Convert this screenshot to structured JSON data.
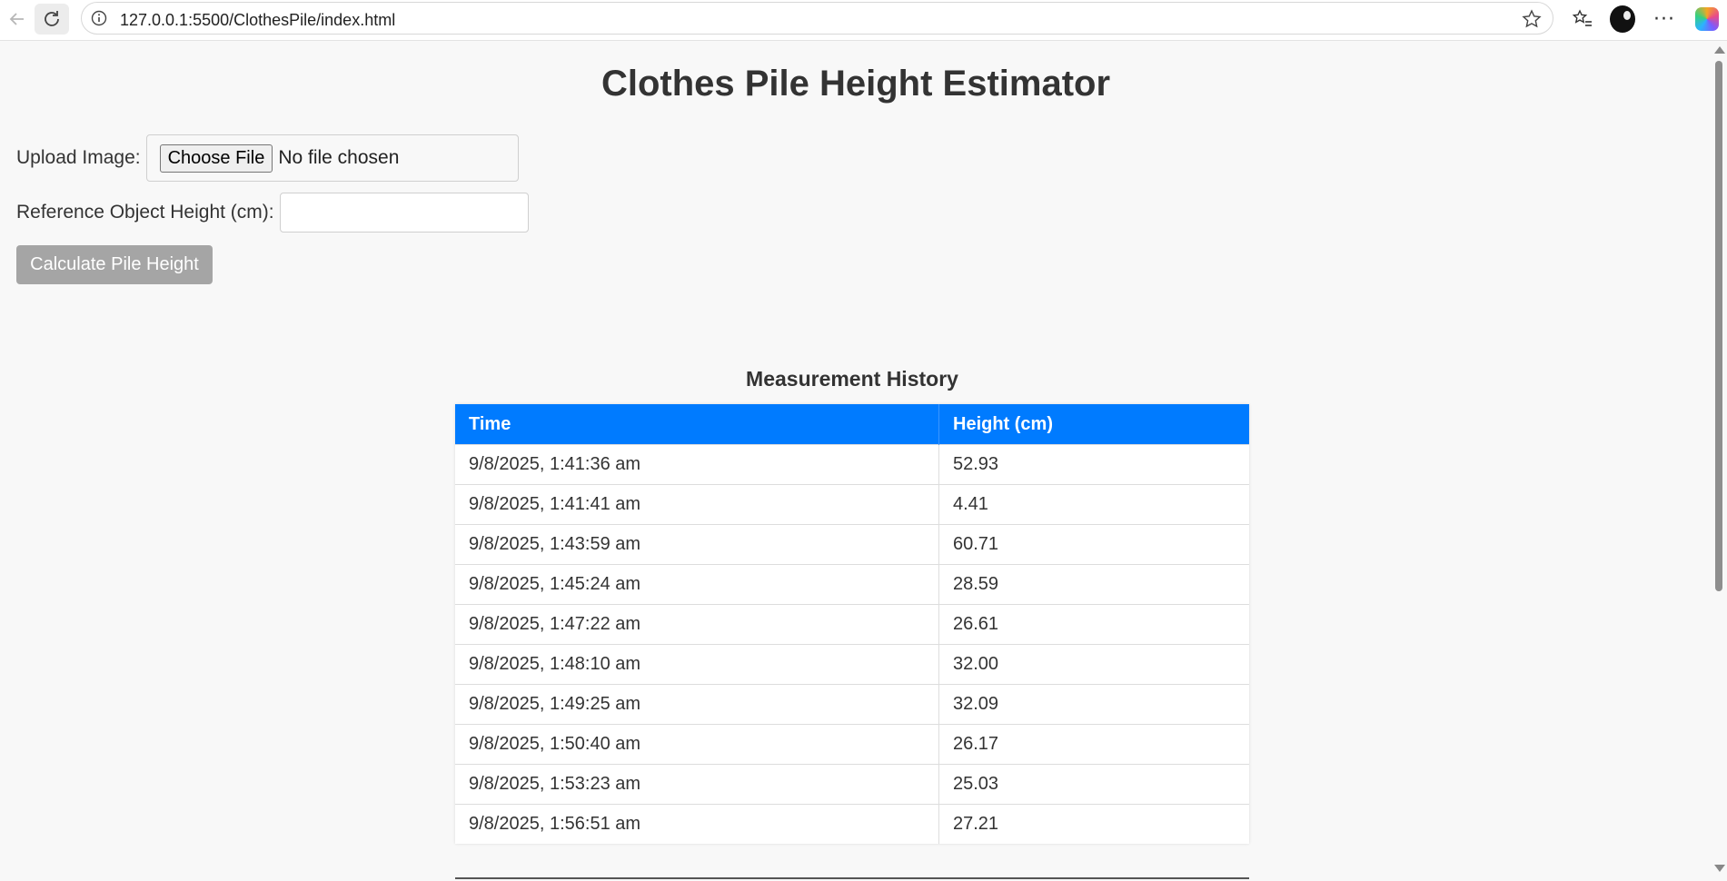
{
  "browser": {
    "url": "127.0.0.1:5500/ClothesPile/index.html"
  },
  "page": {
    "title": "Clothes Pile Height Estimator"
  },
  "form": {
    "upload_label": "Upload Image:",
    "file_button_label": "Choose File",
    "file_status": "No file chosen",
    "reference_label": "Reference Object Height (cm):",
    "reference_value": "",
    "calculate_label": "Calculate Pile Height"
  },
  "history": {
    "title": "Measurement History",
    "columns": [
      "Time",
      "Height (cm)"
    ],
    "rows": [
      {
        "time": "9/8/2025, 1:41:36 am",
        "height": "52.93"
      },
      {
        "time": "9/8/2025, 1:41:41 am",
        "height": "4.41"
      },
      {
        "time": "9/8/2025, 1:43:59 am",
        "height": "60.71"
      },
      {
        "time": "9/8/2025, 1:45:24 am",
        "height": "28.59"
      },
      {
        "time": "9/8/2025, 1:47:22 am",
        "height": "26.61"
      },
      {
        "time": "9/8/2025, 1:48:10 am",
        "height": "32.00"
      },
      {
        "time": "9/8/2025, 1:49:25 am",
        "height": "32.09"
      },
      {
        "time": "9/8/2025, 1:50:40 am",
        "height": "26.17"
      },
      {
        "time": "9/8/2025, 1:53:23 am",
        "height": "25.03"
      },
      {
        "time": "9/8/2025, 1:56:51 am",
        "height": "27.21"
      }
    ]
  },
  "colors": {
    "header_blue": "#007bff",
    "button_gray": "#a5a5a5",
    "page_bg": "#f8f8f8"
  }
}
